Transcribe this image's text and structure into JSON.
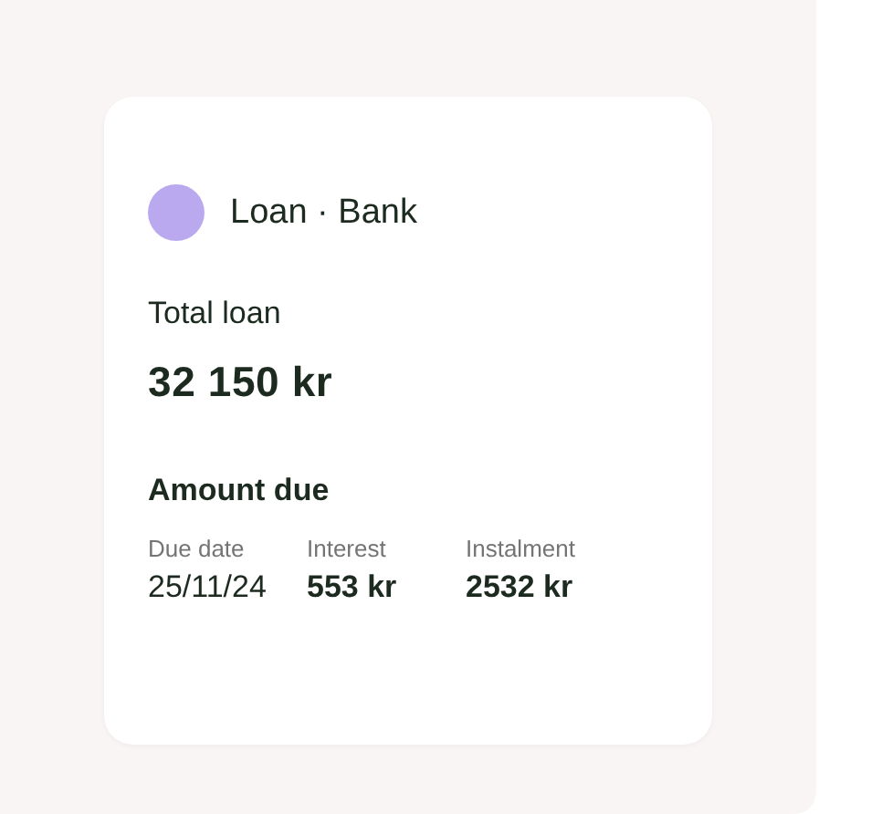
{
  "account": {
    "title": "Loan · Bank"
  },
  "total": {
    "label": "Total loan",
    "value": "32 150 kr"
  },
  "amount_due": {
    "heading": "Amount due",
    "fields": [
      {
        "label": "Due date",
        "value": "25/11/24"
      },
      {
        "label": "Interest",
        "value": "553 kr"
      },
      {
        "label": "Instalment",
        "value": "2532 kr"
      }
    ]
  }
}
